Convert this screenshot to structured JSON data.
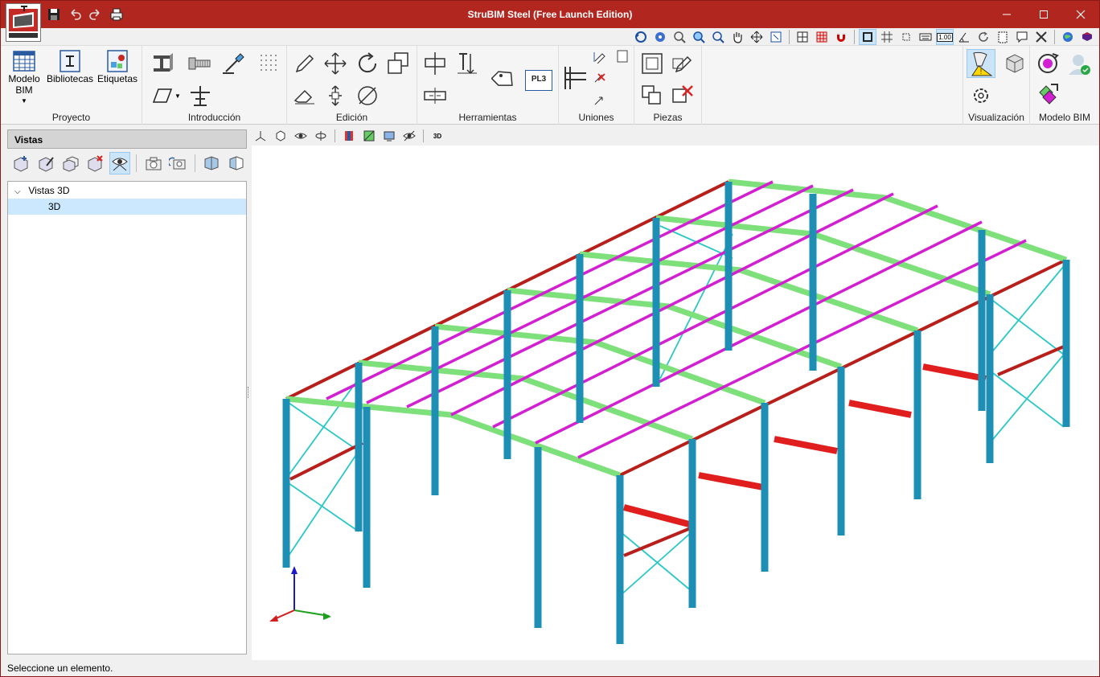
{
  "window": {
    "title": "StruBIM Steel (Free Launch Edition)"
  },
  "ribbon": {
    "groups": [
      {
        "label": "Proyecto"
      },
      {
        "label": "Introducción"
      },
      {
        "label": "Edición"
      },
      {
        "label": "Herramientas"
      },
      {
        "label": "Uniones"
      },
      {
        "label": "Piezas"
      },
      {
        "label": "Visualización"
      },
      {
        "label": "Modelo BIM"
      }
    ],
    "proyecto": {
      "modelo_bim_line1": "Modelo",
      "modelo_bim_line2": "BIM",
      "bibliotecas": "Bibliotecas",
      "etiquetas": "Etiquetas"
    },
    "herramientas": {
      "plate_tag": "PL3"
    }
  },
  "quickbar": {
    "scale_label": "1.00"
  },
  "left_panel": {
    "header": "Vistas",
    "tree": {
      "group_label": "Vistas 3D",
      "items": [
        "3D"
      ]
    }
  },
  "viewport_toolbar": {
    "view_3d_label": "3D"
  },
  "status": {
    "text": "Seleccione un elemento."
  },
  "colors": {
    "titlebar": "#b1261f",
    "columns": "#1e8fb4",
    "rafters": "#7ee07a",
    "purlins": "#d21fd2",
    "eave_beams": "#b81f1a",
    "bracing": "#2ac7c7",
    "struts": "#e01e1e"
  }
}
